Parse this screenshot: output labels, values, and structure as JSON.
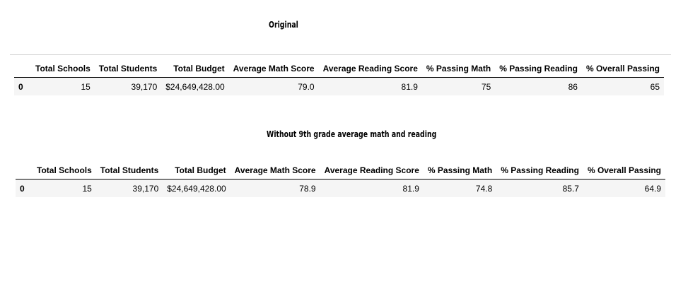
{
  "original": {
    "title": "Original",
    "columns": [
      "Total Schools",
      "Total Students",
      "Total Budget",
      "Average Math Score",
      "Average Reading Score",
      "% Passing Math",
      "% Passing Reading",
      "% Overall Passing"
    ],
    "rows": [
      {
        "index": "0",
        "cells": [
          "15",
          "39,170",
          "$24,649,428.00",
          "79.0",
          "81.9",
          "75",
          "86",
          "65"
        ]
      }
    ]
  },
  "without_9th": {
    "title": "Without 9th grade average math and reading",
    "columns": [
      "Total Schools",
      "Total Students",
      "Total Budget",
      "Average Math Score",
      "Average Reading Score",
      "% Passing Math",
      "% Passing Reading",
      "% Overall Passing"
    ],
    "rows": [
      {
        "index": "0",
        "cells": [
          "15",
          "39,170",
          "$24,649,428.00",
          "78.9",
          "81.9",
          "74.8",
          "85.7",
          "64.9"
        ]
      }
    ]
  }
}
